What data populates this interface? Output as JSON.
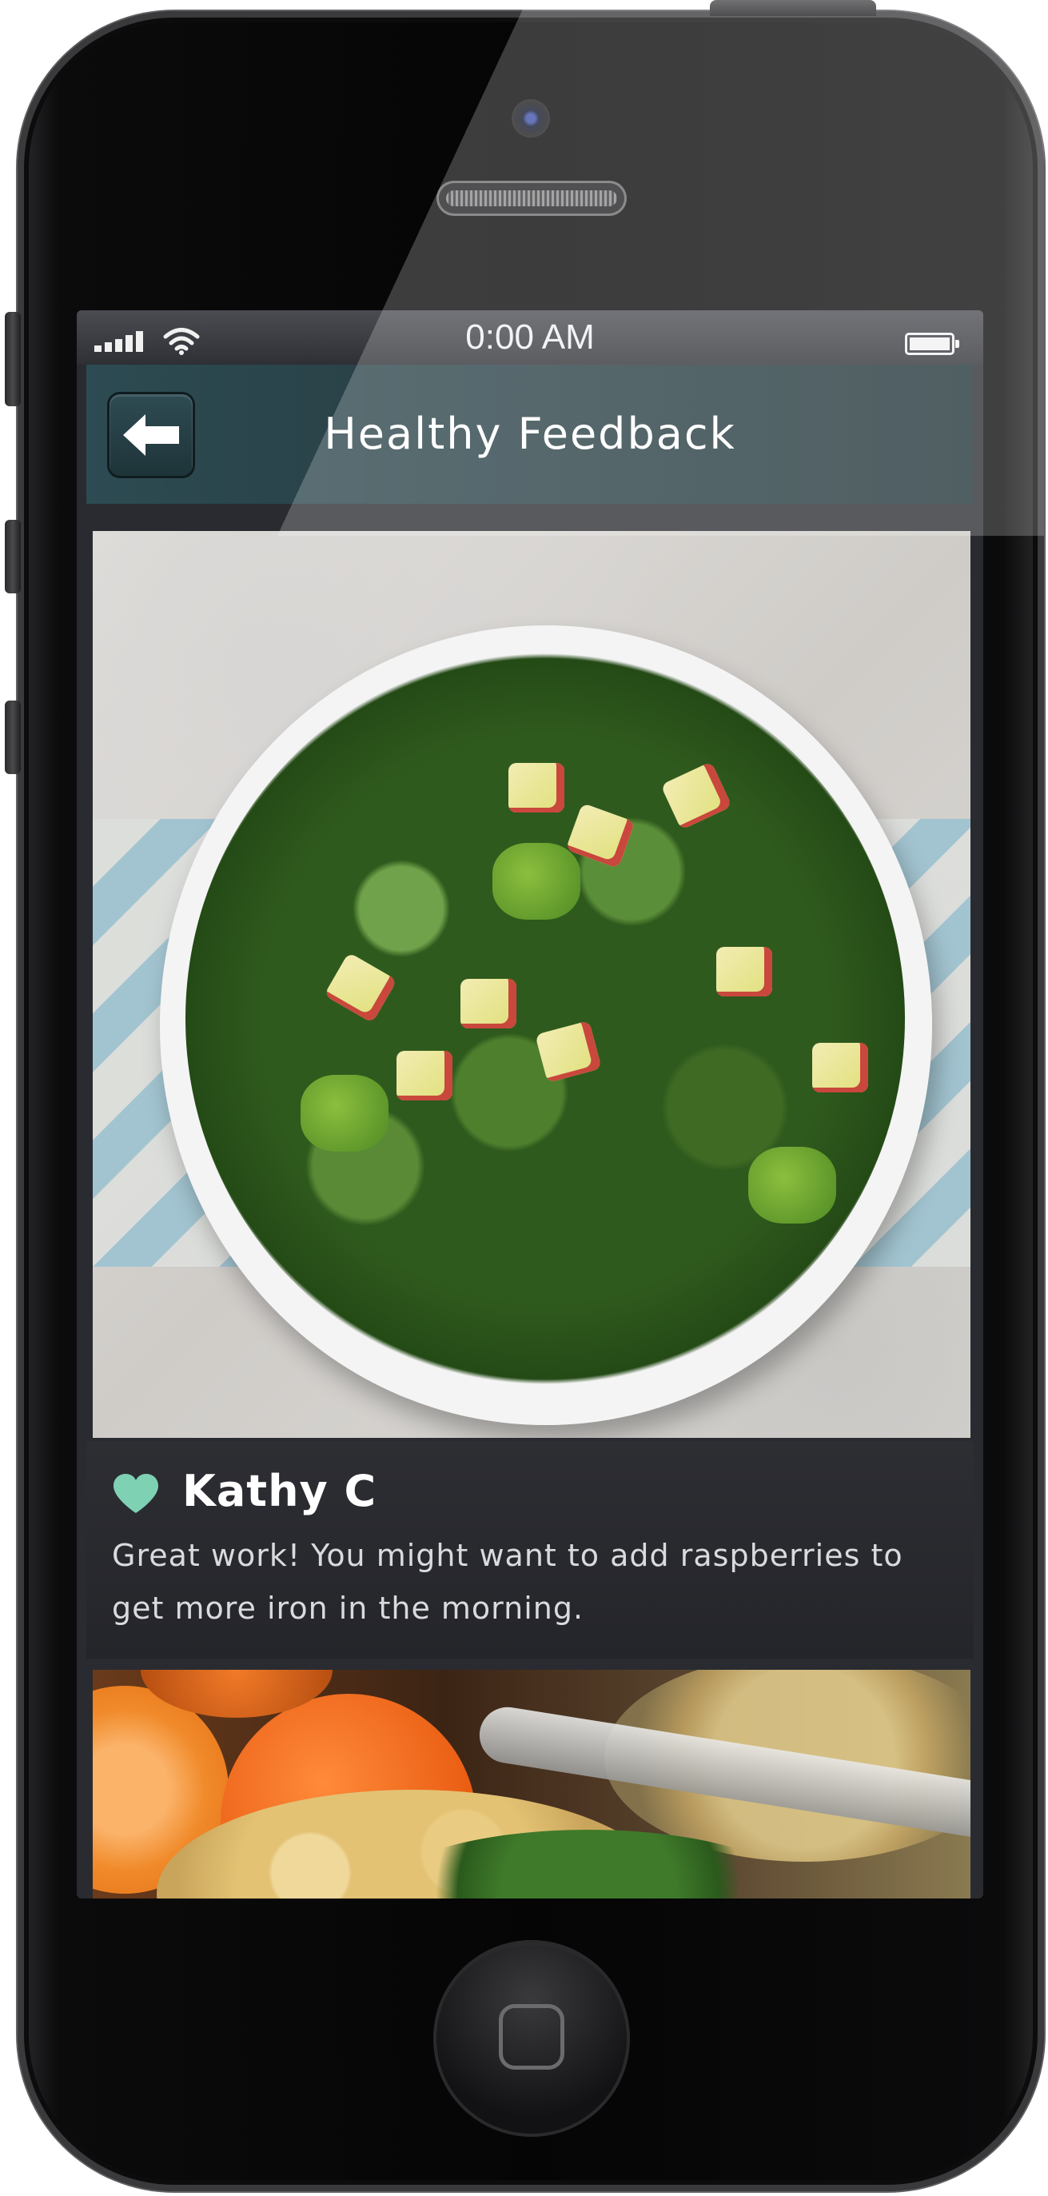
{
  "status_bar": {
    "time": "0:00 AM",
    "signal_icon": "signal-bars-icon",
    "wifi_icon": "wifi-icon",
    "battery_icon": "battery-icon"
  },
  "nav": {
    "title": "Healthy Feedback",
    "back_icon": "arrow-left-icon"
  },
  "feed": {
    "items": [
      {
        "image": "salad-bowl-photo",
        "reviewer": "Kathy C",
        "reaction_icon": "heart-icon",
        "comment": "Great work! You might want to add raspberries to get more iron in the morning."
      },
      {
        "image": "quinoa-orange-photo"
      }
    ]
  },
  "colors": {
    "nav_bar": "#284046",
    "card_bg": "#2a2b30",
    "heart": "#7fd1b4",
    "text_primary": "#ffffff",
    "text_secondary": "#d9dadd"
  }
}
